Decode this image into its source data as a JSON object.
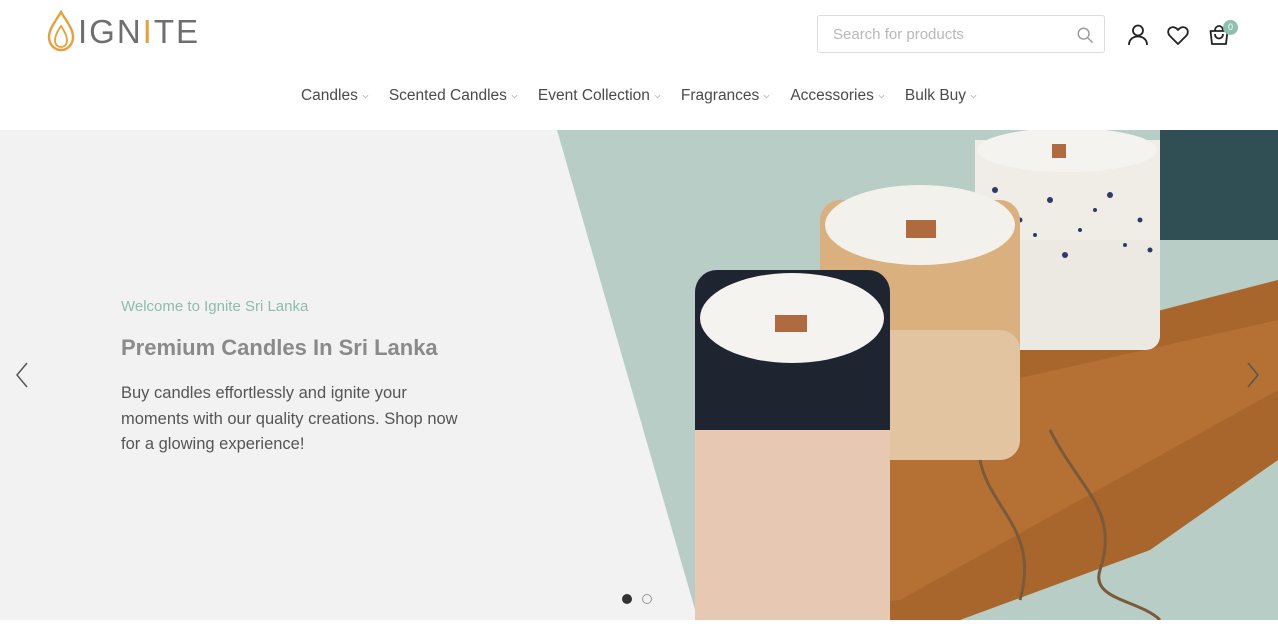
{
  "brand": {
    "logo_prefix": "IGN",
    "logo_accent": "I",
    "logo_suffix": "TE"
  },
  "search": {
    "placeholder": "Search for products"
  },
  "cart": {
    "count": "0"
  },
  "nav": {
    "items": [
      {
        "label": "Candles"
      },
      {
        "label": "Scented Candles"
      },
      {
        "label": "Event Collection"
      },
      {
        "label": "Fragrances"
      },
      {
        "label": "Accessories"
      },
      {
        "label": "Bulk Buy"
      }
    ]
  },
  "hero": {
    "kicker": "Welcome to Ignite Sri Lanka",
    "title": "Premium Candles In Sri Lanka",
    "description": "Buy candles effortlessly and ignite your moments with our quality creations. Shop now for a glowing experience!",
    "slides_total": 2,
    "active_slide": 1
  },
  "colors": {
    "accent": "#8fbfb0",
    "logo_flame": "#e8a13a",
    "hero_bg": "#f2f2f2",
    "photo_bg": "#b7cdc6"
  },
  "icons": [
    "search-icon",
    "user-icon",
    "heart-icon",
    "cart-icon",
    "chevron-down-icon",
    "arrow-left-icon",
    "arrow-right-icon"
  ]
}
